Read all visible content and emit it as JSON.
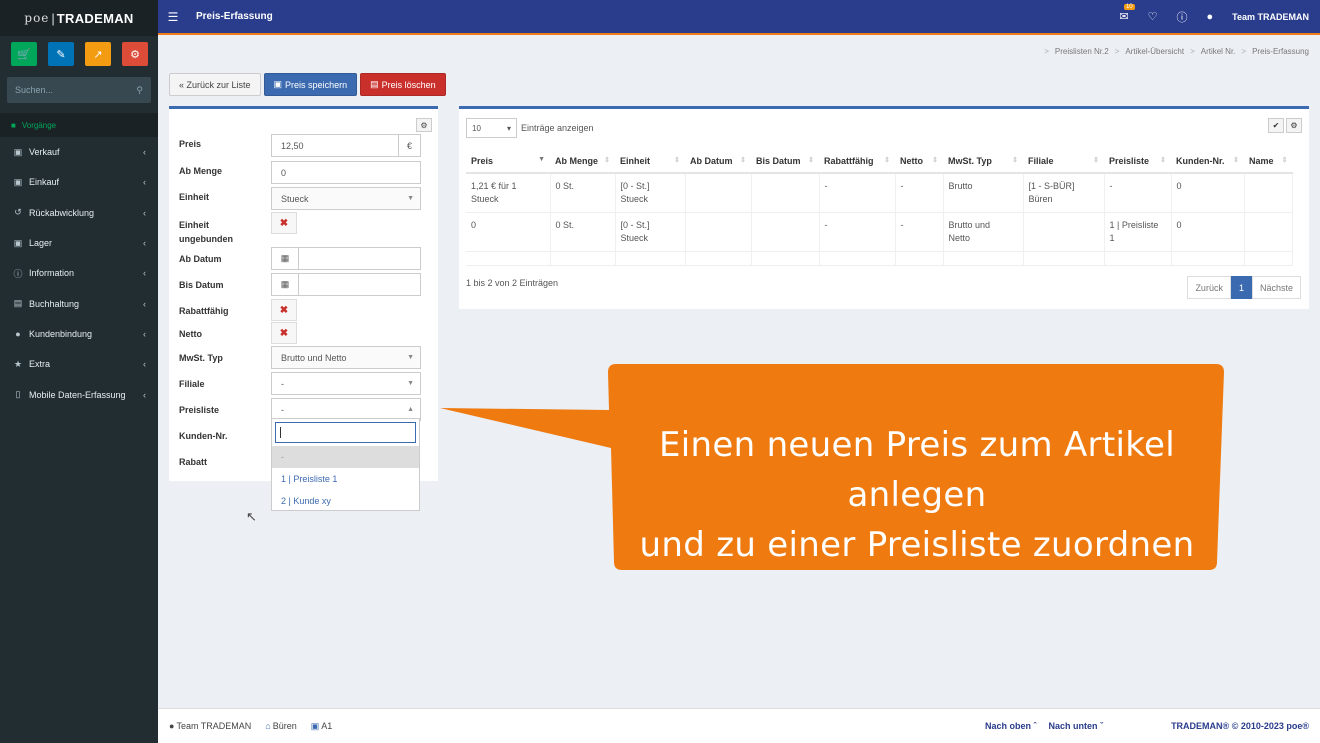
{
  "logo": {
    "poe": "poe",
    "brand": "TRADEMAN"
  },
  "sidebar": {
    "search_placeholder": "Suchen...",
    "section": "Vorgänge",
    "items": [
      {
        "label": "Verkauf",
        "icon": "monitor-icon"
      },
      {
        "label": "Einkauf",
        "icon": "cart-icon"
      },
      {
        "label": "Rückabwicklung",
        "icon": "undo-icon"
      },
      {
        "label": "Lager",
        "icon": "truck-icon"
      },
      {
        "label": "Information",
        "icon": "info-icon"
      },
      {
        "label": "Buchhaltung",
        "icon": "money-icon"
      },
      {
        "label": "Kundenbindung",
        "icon": "users-icon"
      },
      {
        "label": "Extra",
        "icon": "star-icon"
      },
      {
        "label": "Mobile Daten-Erfassung",
        "icon": "mobile-icon"
      }
    ],
    "quick_buttons": [
      {
        "name": "cart",
        "color": "#00a65a"
      },
      {
        "name": "edit",
        "color": "#0073b7"
      },
      {
        "name": "chart",
        "color": "#f39c12"
      },
      {
        "name": "settings",
        "color": "#dd4b39"
      }
    ]
  },
  "topbar": {
    "title": "Preis-Erfassung",
    "badge": "10",
    "user": "Team TRADEMAN"
  },
  "breadcrumb": [
    "Preislisten Nr.2",
    "Artikel-Übersicht",
    "Artikel Nr.",
    "Preis-Erfassung"
  ],
  "actions": {
    "back": "« Zurück zur Liste",
    "save": "Preis speichern",
    "delete": "Preis löschen"
  },
  "form": {
    "preis_label": "Preis",
    "preis_value": "12,50",
    "currency": "€",
    "ab_menge_label": "Ab Menge",
    "ab_menge_value": "0",
    "einheit_label": "Einheit",
    "einheit_value": "Stueck",
    "einheit_ungebunden_label_1": "Einheit",
    "einheit_ungebunden_label_2": "ungebunden",
    "ab_datum_label": "Ab Datum",
    "bis_datum_label": "Bis Datum",
    "rabattfaehig_label": "Rabattfähig",
    "netto_label": "Netto",
    "mwst_label": "MwSt. Typ",
    "mwst_value": "Brutto und Netto",
    "filiale_label": "Filiale",
    "filiale_value": "-",
    "preisliste_label": "Preisliste",
    "preisliste_value": "-",
    "kunden_label": "Kunden-Nr.",
    "rabatt_label": "Rabatt"
  },
  "dropdown": {
    "options": [
      "-",
      "1 | Preisliste 1",
      "2 | Kunde xy"
    ]
  },
  "table": {
    "length": "10",
    "length_label": "Einträge anzeigen",
    "headers": [
      "Preis",
      "Ab Menge",
      "Einheit",
      "Ab Datum",
      "Bis Datum",
      "Rabattfähig",
      "Netto",
      "MwSt. Typ",
      "Filiale",
      "Preisliste",
      "Kunden-Nr.",
      "Name"
    ],
    "rows": [
      {
        "preis_1": "1,21 € für 1",
        "preis_2": "Stueck",
        "ab_menge": "0 St.",
        "einheit": "[0 - St.] Stueck",
        "ab_datum": "",
        "bis_datum": "",
        "rabatt": "-",
        "netto": "-",
        "mwst_1": "Brutto",
        "mwst_2": "",
        "filiale": "[1 - S-BÜR] Büren",
        "preisliste": "-",
        "kunden": "0",
        "name": ""
      },
      {
        "preis_1": "0",
        "preis_2": "",
        "ab_menge": "0 St.",
        "einheit": "[0 - St.] Stueck",
        "ab_datum": "",
        "bis_datum": "",
        "rabatt": "-",
        "netto": "-",
        "mwst_1": "Brutto und",
        "mwst_2": "Netto",
        "filiale": "",
        "preisliste": "1 | Preisliste 1",
        "kunden": "0",
        "name": ""
      }
    ],
    "info": "1 bis 2 von 2 Einträgen",
    "pager": {
      "prev": "Zurück",
      "current": "1",
      "next": "Nächste"
    }
  },
  "callout": {
    "line1": "Einen neuen Preis zum Artikel anlegen",
    "line2": "und zu einer Preisliste zuordnen",
    "color": "#ef7a10"
  },
  "footer": {
    "user": "Team TRADEMAN",
    "location": "Büren",
    "terminal": "A1",
    "top": "Nach oben",
    "bottom": "Nach unten",
    "copyright": "TRADEMAN® © 2010-2023 poe®"
  }
}
